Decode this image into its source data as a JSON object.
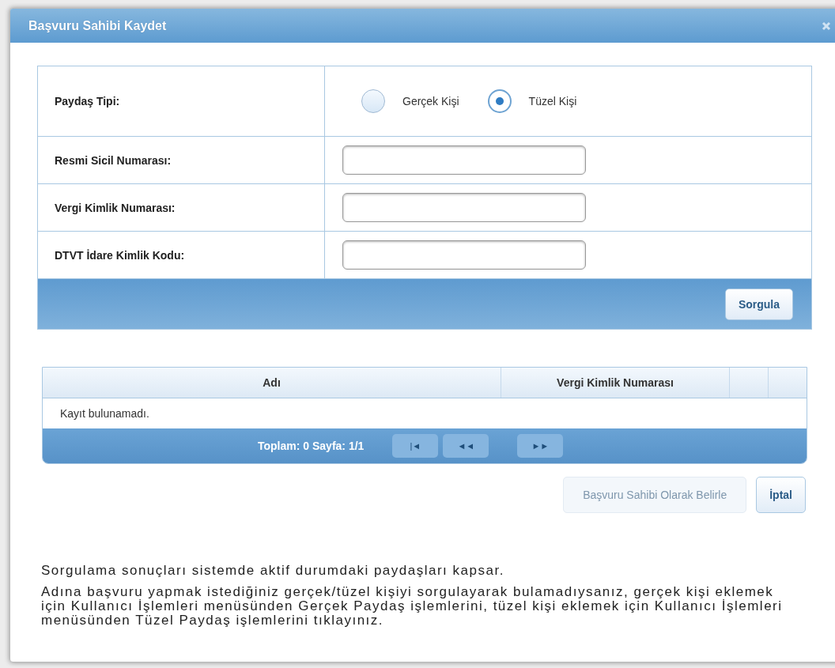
{
  "dialog": {
    "title": "Başvuru Sahibi Kaydet"
  },
  "form": {
    "type_label": "Paydaş Tipi:",
    "options": [
      {
        "label": "Gerçek Kişi",
        "selected": false
      },
      {
        "label": "Tüzel Kişi",
        "selected": true
      }
    ],
    "fields": [
      {
        "label": "Resmi Sicil Numarası:"
      },
      {
        "label": "Vergi Kimlik Numarası:"
      },
      {
        "label": "DTVT İdare Kimlik Kodu:"
      }
    ],
    "query_button": "Sorgula"
  },
  "table": {
    "columns": [
      "Adı",
      "Vergi Kimlik Numarası"
    ],
    "empty_text": "Kayıt bulunamadı.",
    "pager": {
      "summary": "Toplam: 0 Sayfa: 1/1",
      "buttons": [
        {
          "label": "|◄",
          "disabled": true
        },
        {
          "label": "◄◄",
          "disabled": true
        },
        {
          "label": "►►",
          "disabled": true
        }
      ]
    }
  },
  "actions": [
    {
      "label": "Başvuru Sahibi Olarak Belirle",
      "disabled": true
    },
    {
      "label": "İptal",
      "disabled": false
    }
  ],
  "notes": [
    "Sorgulama sonuçları sistemde aktif durumdaki paydaşları kapsar.",
    "Adına başvuru yapmak istediğiniz gerçek/tüzel kişiyi sorgulayarak bulamadıysanız, gerçek kişi eklemek için Kullanıcı İşlemleri menüsünden Gerçek Paydaş işlemlerini, tüzel kişi eklemek için Kullanıcı İşlemleri menüsünden Tüzel Paydaş işlemlerini tıklayınız."
  ]
}
